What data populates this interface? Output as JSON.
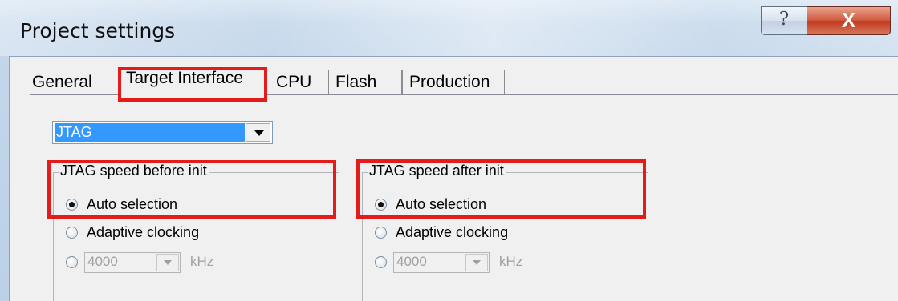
{
  "window": {
    "title": "Project settings",
    "help_label": "?",
    "close_label": "X"
  },
  "tabs": [
    {
      "label": "General"
    },
    {
      "label": "Target Interface",
      "selected": true
    },
    {
      "label": "CPU"
    },
    {
      "label": "Flash"
    },
    {
      "label": "Production"
    }
  ],
  "interface_select": {
    "value": "JTAG"
  },
  "group_before": {
    "title": "JTAG speed before init",
    "options": [
      "Auto selection",
      "Adaptive clocking"
    ],
    "speed_value": "4000",
    "unit": "kHz",
    "selected": "Auto selection"
  },
  "group_after": {
    "title": "JTAG speed after init",
    "options": [
      "Auto selection",
      "Adaptive clocking"
    ],
    "speed_value": "4000",
    "unit": "kHz",
    "selected": "Auto selection"
  },
  "colors": {
    "highlight": "#e31b1b",
    "selection": "#3399ff",
    "close_button": "#c0391f"
  }
}
